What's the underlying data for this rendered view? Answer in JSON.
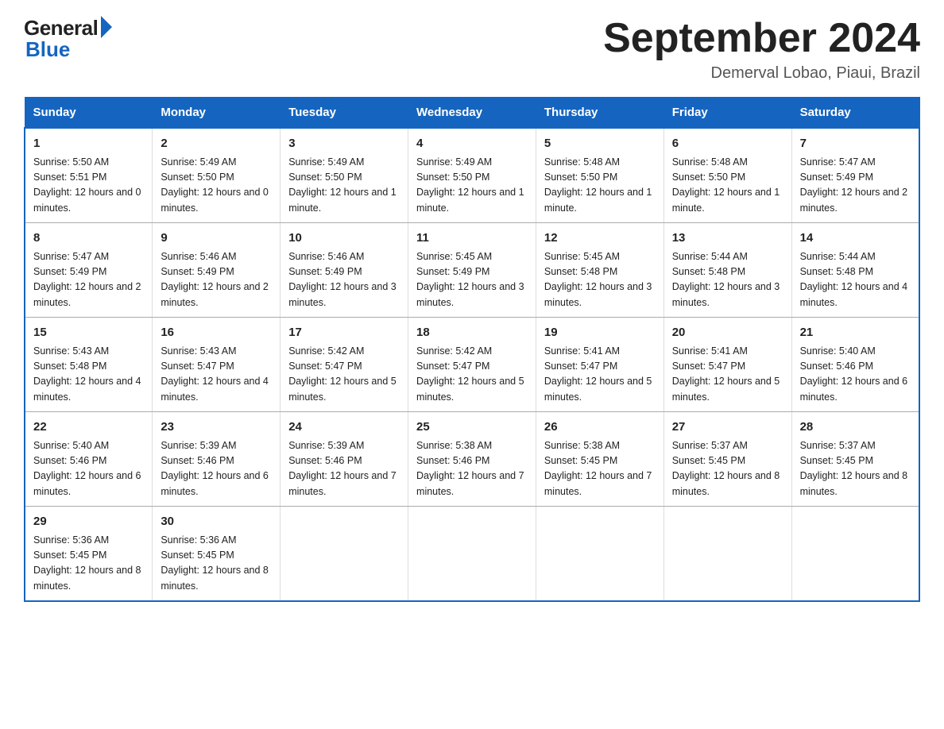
{
  "header": {
    "logo_general": "General",
    "logo_blue": "Blue",
    "month_title": "September 2024",
    "location": "Demerval Lobao, Piaui, Brazil"
  },
  "days_of_week": [
    "Sunday",
    "Monday",
    "Tuesday",
    "Wednesday",
    "Thursday",
    "Friday",
    "Saturday"
  ],
  "weeks": [
    [
      {
        "day": "1",
        "sunrise": "5:50 AM",
        "sunset": "5:51 PM",
        "daylight": "12 hours and 0 minutes."
      },
      {
        "day": "2",
        "sunrise": "5:49 AM",
        "sunset": "5:50 PM",
        "daylight": "12 hours and 0 minutes."
      },
      {
        "day": "3",
        "sunrise": "5:49 AM",
        "sunset": "5:50 PM",
        "daylight": "12 hours and 1 minute."
      },
      {
        "day": "4",
        "sunrise": "5:49 AM",
        "sunset": "5:50 PM",
        "daylight": "12 hours and 1 minute."
      },
      {
        "day": "5",
        "sunrise": "5:48 AM",
        "sunset": "5:50 PM",
        "daylight": "12 hours and 1 minute."
      },
      {
        "day": "6",
        "sunrise": "5:48 AM",
        "sunset": "5:50 PM",
        "daylight": "12 hours and 1 minute."
      },
      {
        "day": "7",
        "sunrise": "5:47 AM",
        "sunset": "5:49 PM",
        "daylight": "12 hours and 2 minutes."
      }
    ],
    [
      {
        "day": "8",
        "sunrise": "5:47 AM",
        "sunset": "5:49 PM",
        "daylight": "12 hours and 2 minutes."
      },
      {
        "day": "9",
        "sunrise": "5:46 AM",
        "sunset": "5:49 PM",
        "daylight": "12 hours and 2 minutes."
      },
      {
        "day": "10",
        "sunrise": "5:46 AM",
        "sunset": "5:49 PM",
        "daylight": "12 hours and 3 minutes."
      },
      {
        "day": "11",
        "sunrise": "5:45 AM",
        "sunset": "5:49 PM",
        "daylight": "12 hours and 3 minutes."
      },
      {
        "day": "12",
        "sunrise": "5:45 AM",
        "sunset": "5:48 PM",
        "daylight": "12 hours and 3 minutes."
      },
      {
        "day": "13",
        "sunrise": "5:44 AM",
        "sunset": "5:48 PM",
        "daylight": "12 hours and 3 minutes."
      },
      {
        "day": "14",
        "sunrise": "5:44 AM",
        "sunset": "5:48 PM",
        "daylight": "12 hours and 4 minutes."
      }
    ],
    [
      {
        "day": "15",
        "sunrise": "5:43 AM",
        "sunset": "5:48 PM",
        "daylight": "12 hours and 4 minutes."
      },
      {
        "day": "16",
        "sunrise": "5:43 AM",
        "sunset": "5:47 PM",
        "daylight": "12 hours and 4 minutes."
      },
      {
        "day": "17",
        "sunrise": "5:42 AM",
        "sunset": "5:47 PM",
        "daylight": "12 hours and 5 minutes."
      },
      {
        "day": "18",
        "sunrise": "5:42 AM",
        "sunset": "5:47 PM",
        "daylight": "12 hours and 5 minutes."
      },
      {
        "day": "19",
        "sunrise": "5:41 AM",
        "sunset": "5:47 PM",
        "daylight": "12 hours and 5 minutes."
      },
      {
        "day": "20",
        "sunrise": "5:41 AM",
        "sunset": "5:47 PM",
        "daylight": "12 hours and 5 minutes."
      },
      {
        "day": "21",
        "sunrise": "5:40 AM",
        "sunset": "5:46 PM",
        "daylight": "12 hours and 6 minutes."
      }
    ],
    [
      {
        "day": "22",
        "sunrise": "5:40 AM",
        "sunset": "5:46 PM",
        "daylight": "12 hours and 6 minutes."
      },
      {
        "day": "23",
        "sunrise": "5:39 AM",
        "sunset": "5:46 PM",
        "daylight": "12 hours and 6 minutes."
      },
      {
        "day": "24",
        "sunrise": "5:39 AM",
        "sunset": "5:46 PM",
        "daylight": "12 hours and 7 minutes."
      },
      {
        "day": "25",
        "sunrise": "5:38 AM",
        "sunset": "5:46 PM",
        "daylight": "12 hours and 7 minutes."
      },
      {
        "day": "26",
        "sunrise": "5:38 AM",
        "sunset": "5:45 PM",
        "daylight": "12 hours and 7 minutes."
      },
      {
        "day": "27",
        "sunrise": "5:37 AM",
        "sunset": "5:45 PM",
        "daylight": "12 hours and 8 minutes."
      },
      {
        "day": "28",
        "sunrise": "5:37 AM",
        "sunset": "5:45 PM",
        "daylight": "12 hours and 8 minutes."
      }
    ],
    [
      {
        "day": "29",
        "sunrise": "5:36 AM",
        "sunset": "5:45 PM",
        "daylight": "12 hours and 8 minutes."
      },
      {
        "day": "30",
        "sunrise": "5:36 AM",
        "sunset": "5:45 PM",
        "daylight": "12 hours and 8 minutes."
      },
      {
        "day": "",
        "sunrise": "",
        "sunset": "",
        "daylight": ""
      },
      {
        "day": "",
        "sunrise": "",
        "sunset": "",
        "daylight": ""
      },
      {
        "day": "",
        "sunrise": "",
        "sunset": "",
        "daylight": ""
      },
      {
        "day": "",
        "sunrise": "",
        "sunset": "",
        "daylight": ""
      },
      {
        "day": "",
        "sunrise": "",
        "sunset": "",
        "daylight": ""
      }
    ]
  ]
}
